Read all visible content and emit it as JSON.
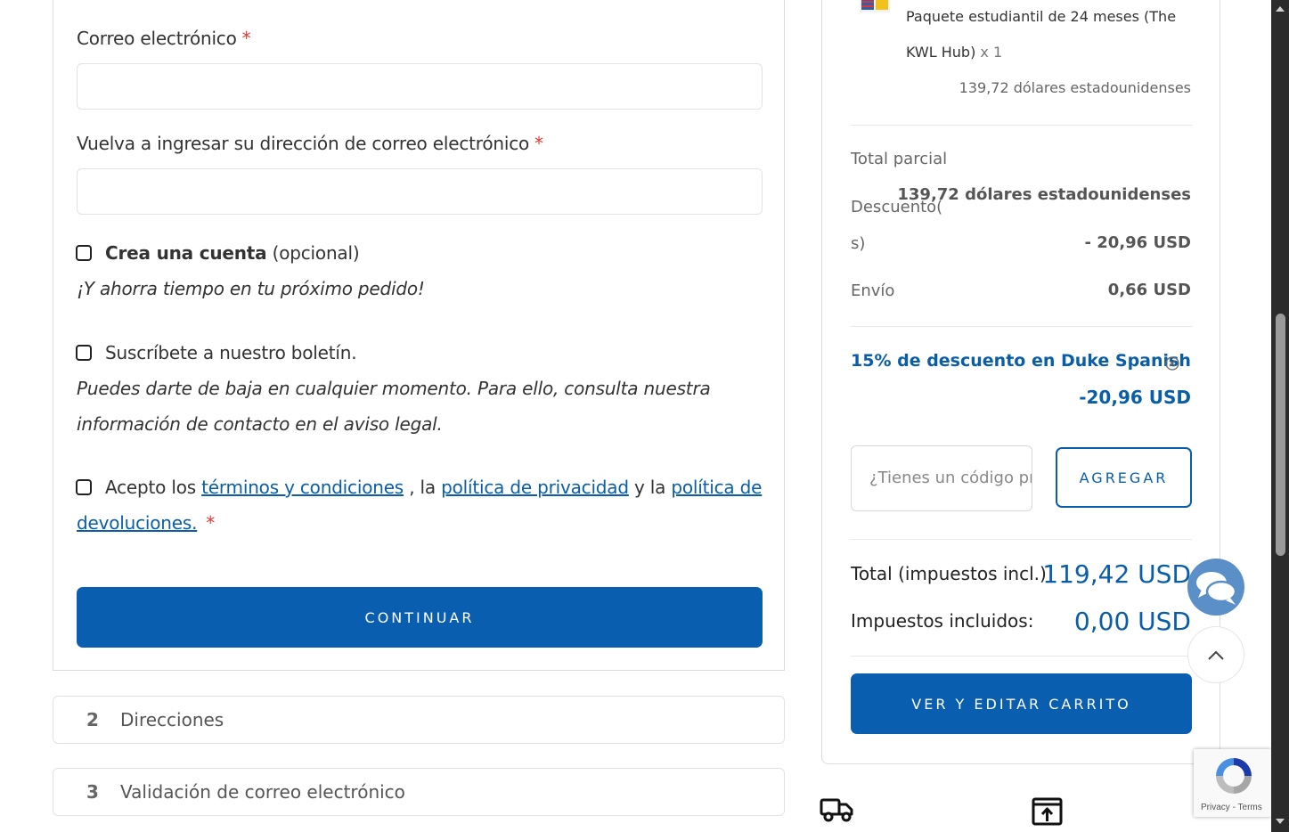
{
  "form": {
    "email_label": "Correo electrónico",
    "email_required": "*",
    "email_value": "",
    "email_confirm_label": "Vuelva a ingresar su dirección de correo electrónico",
    "email_confirm_required": "*",
    "email_confirm_value": "",
    "create_account_bold": "Crea una cuenta",
    "create_account_rest": " (opcional)",
    "create_account_note": "¡Y ahorra tiempo en tu próximo pedido!",
    "newsletter_label": "Suscríbete a nuestro boletín.",
    "newsletter_note_line1": "Puedes darte de baja en cualquier momento. Para ello, consulta nuestra",
    "newsletter_note_line2": "información de contacto en el aviso legal.",
    "terms_prefix": "Acepto los ",
    "terms_link": "términos y condiciones",
    "terms_mid1": " , la ",
    "privacy_link": "política de privacidad",
    "terms_mid2": " y la ",
    "returns_link_part1": "política de",
    "returns_link_part2": "devoluciones.",
    "terms_required": "*",
    "continue_label": "CONTINUAR"
  },
  "steps": [
    {
      "number": "2",
      "title": "Direcciones"
    },
    {
      "number": "3",
      "title": "Validación de correo electrónico"
    }
  ],
  "summary": {
    "product_name_line1": "Paquete estudiantil de 24 meses (The",
    "product_name_line2": "KWL Hub)",
    "product_qty": " x 1",
    "product_price": "139,72 dólares estadounidenses",
    "subtotal_label": "Total parcial",
    "subtotal_value": "139,72 dólares estadounidenses",
    "discount_label_line1": "Descuento(",
    "discount_label_line2": "s)",
    "discount_value": "- 20,96 USD",
    "shipping_label": "Envío",
    "shipping_value": "0,66 USD",
    "promo_applied_name": "15% de descuento en Duke Spanish",
    "promo_applied_value": "-20,96 USD",
    "promo_placeholder": "¿Tienes un código promocional?",
    "promo_add_label": "AGREGAR",
    "total_label": "Total (impuestos incl.)",
    "total_value": "119,42 USD",
    "taxes_label": "Impuestos incluidos:",
    "taxes_value": "0,00 USD",
    "cart_button_label": "VER Y EDITAR CARRITO"
  },
  "recaptcha": {
    "privacy": "Privacy",
    "separator": " - ",
    "terms": "Terms"
  },
  "colors": {
    "brand_blue": "#0a5eb0",
    "link_blue": "#0a5ea8",
    "required_red": "#e53935",
    "chat_blue": "#5b8fc7"
  }
}
